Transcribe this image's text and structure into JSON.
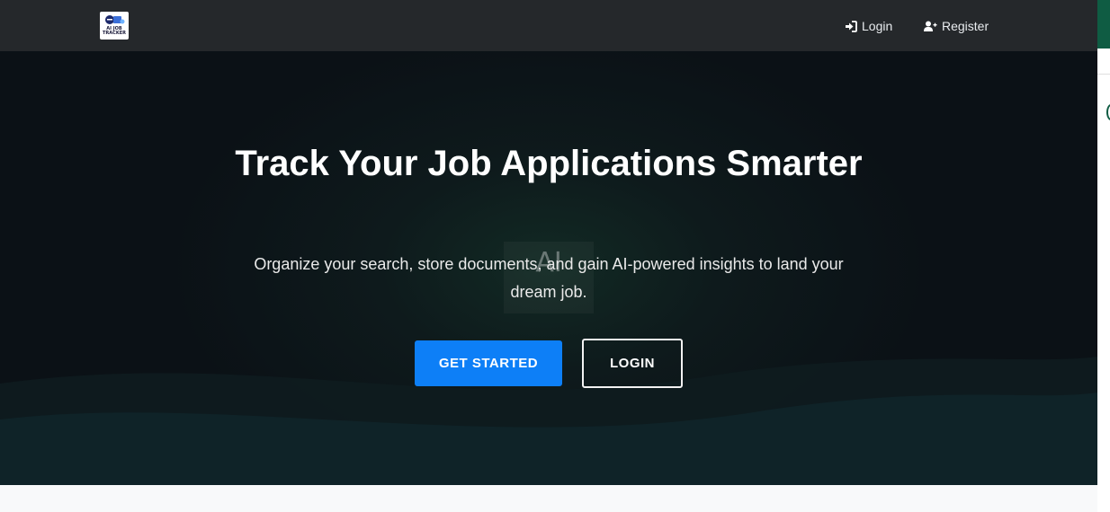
{
  "navbar": {
    "logo_text": "AI JOB TRACKER",
    "login_label": "Login",
    "register_label": "Register"
  },
  "hero": {
    "title": "Track Your Job Applications Smarter",
    "subtitle": "Organize your search, store documents, and gain AI-powered insights to land your dream job.",
    "watermark": "AI",
    "get_started_label": "GET STARTED",
    "login_button_label": "LOGIN"
  },
  "colors": {
    "navbar_bg": "#25282b",
    "hero_bg": "#0b1116",
    "primary": "#0d7ff7",
    "edge_accent": "#0f5c43"
  },
  "icons": {
    "login": "sign-in-icon",
    "register": "user-plus-icon"
  }
}
